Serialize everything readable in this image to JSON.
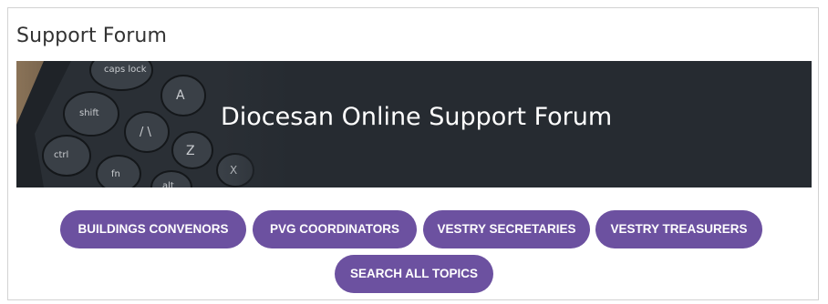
{
  "page": {
    "title": "Support Forum"
  },
  "banner": {
    "heading": "Diocesan Online Support Forum",
    "keyboard_keys": [
      "caps lock",
      "shift",
      "ctrl",
      "fn",
      "A",
      "Z",
      "X",
      "alt",
      "/ \\"
    ]
  },
  "topics": [
    {
      "label": "BUILDINGS CONVENORS"
    },
    {
      "label": "PVG COORDINATORS"
    },
    {
      "label": "VESTRY SECRETARIES"
    },
    {
      "label": "VESTRY TREASURERS"
    },
    {
      "label": "SEARCH ALL TOPICS"
    }
  ],
  "colors": {
    "button": "#6c51a0",
    "banner_bg": "#262b31",
    "border": "#d2d2d2"
  }
}
